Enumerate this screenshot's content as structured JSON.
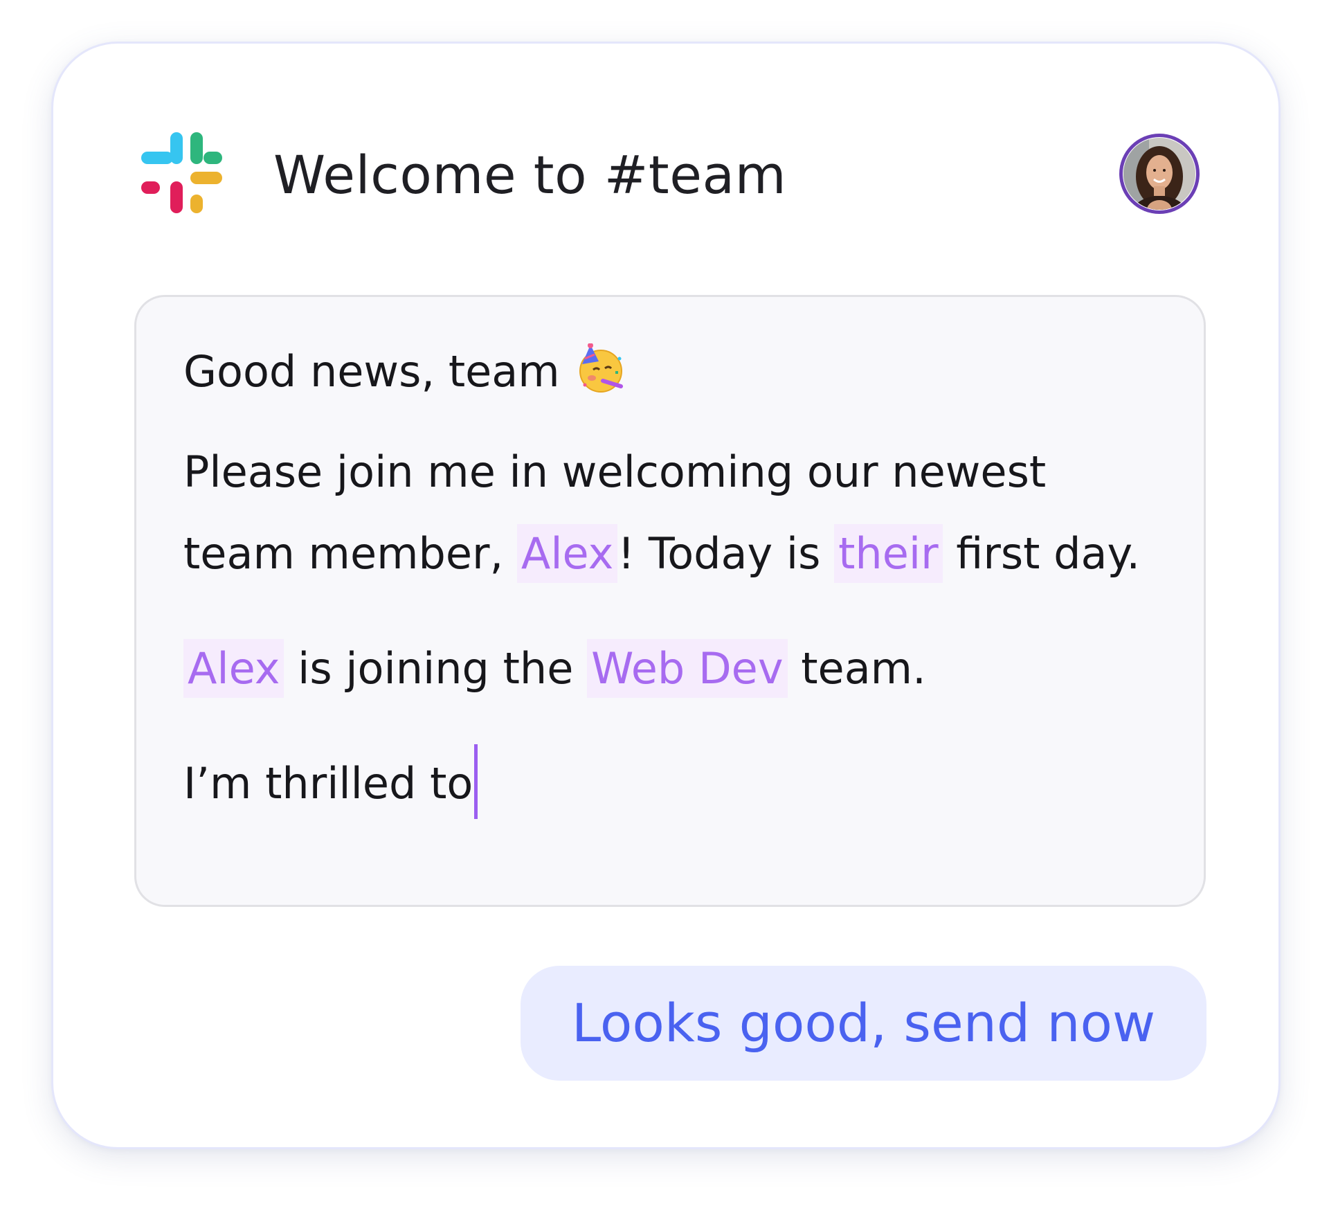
{
  "header": {
    "logo_icon": "slack-logo-icon",
    "title": "Welcome to #team",
    "avatar_icon": "user-avatar-photo"
  },
  "message": {
    "line1": "Good news, team",
    "line1_emoji": "partying-face-emoji",
    "p2_a": "Please join me in welcoming our newest",
    "p2_b": "team member, ",
    "p2_name": "Alex",
    "p2_c": "! Today is ",
    "p2_pronoun": "their",
    "p2_d": " first day.",
    "p3_name": "Alex",
    "p3_a": " is joining the ",
    "p3_team": "Web Dev",
    "p3_b": " team.",
    "p4": "I’m thrilled to"
  },
  "actions": {
    "send_label": "Looks good, send now"
  },
  "colors": {
    "highlight_text": "#a76bf0",
    "highlight_bg": "#f6ecfd",
    "button_bg": "#e9ecff",
    "button_text": "#4a62f0",
    "avatar_ring": "#6b3fb5"
  }
}
